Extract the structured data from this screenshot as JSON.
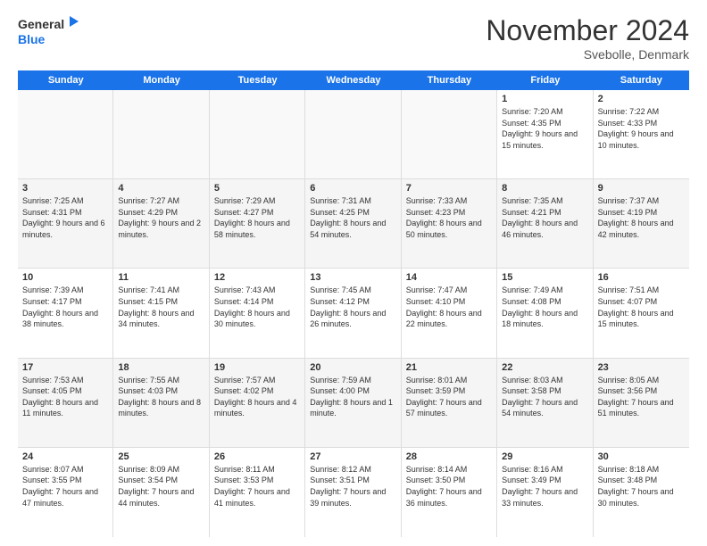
{
  "header": {
    "logo_general": "General",
    "logo_blue": "Blue",
    "month_title": "November 2024",
    "location": "Svebolle, Denmark"
  },
  "calendar": {
    "days_of_week": [
      "Sunday",
      "Monday",
      "Tuesday",
      "Wednesday",
      "Thursday",
      "Friday",
      "Saturday"
    ],
    "weeks": [
      [
        {
          "day": "",
          "empty": true
        },
        {
          "day": "",
          "empty": true
        },
        {
          "day": "",
          "empty": true
        },
        {
          "day": "",
          "empty": true
        },
        {
          "day": "",
          "empty": true
        },
        {
          "day": "1",
          "sunrise": "7:20 AM",
          "sunset": "4:35 PM",
          "daylight": "9 hours and 15 minutes."
        },
        {
          "day": "2",
          "sunrise": "7:22 AM",
          "sunset": "4:33 PM",
          "daylight": "9 hours and 10 minutes."
        }
      ],
      [
        {
          "day": "3",
          "sunrise": "7:25 AM",
          "sunset": "4:31 PM",
          "daylight": "9 hours and 6 minutes."
        },
        {
          "day": "4",
          "sunrise": "7:27 AM",
          "sunset": "4:29 PM",
          "daylight": "9 hours and 2 minutes."
        },
        {
          "day": "5",
          "sunrise": "7:29 AM",
          "sunset": "4:27 PM",
          "daylight": "8 hours and 58 minutes."
        },
        {
          "day": "6",
          "sunrise": "7:31 AM",
          "sunset": "4:25 PM",
          "daylight": "8 hours and 54 minutes."
        },
        {
          "day": "7",
          "sunrise": "7:33 AM",
          "sunset": "4:23 PM",
          "daylight": "8 hours and 50 minutes."
        },
        {
          "day": "8",
          "sunrise": "7:35 AM",
          "sunset": "4:21 PM",
          "daylight": "8 hours and 46 minutes."
        },
        {
          "day": "9",
          "sunrise": "7:37 AM",
          "sunset": "4:19 PM",
          "daylight": "8 hours and 42 minutes."
        }
      ],
      [
        {
          "day": "10",
          "sunrise": "7:39 AM",
          "sunset": "4:17 PM",
          "daylight": "8 hours and 38 minutes."
        },
        {
          "day": "11",
          "sunrise": "7:41 AM",
          "sunset": "4:15 PM",
          "daylight": "8 hours and 34 minutes."
        },
        {
          "day": "12",
          "sunrise": "7:43 AM",
          "sunset": "4:14 PM",
          "daylight": "8 hours and 30 minutes."
        },
        {
          "day": "13",
          "sunrise": "7:45 AM",
          "sunset": "4:12 PM",
          "daylight": "8 hours and 26 minutes."
        },
        {
          "day": "14",
          "sunrise": "7:47 AM",
          "sunset": "4:10 PM",
          "daylight": "8 hours and 22 minutes."
        },
        {
          "day": "15",
          "sunrise": "7:49 AM",
          "sunset": "4:08 PM",
          "daylight": "8 hours and 18 minutes."
        },
        {
          "day": "16",
          "sunrise": "7:51 AM",
          "sunset": "4:07 PM",
          "daylight": "8 hours and 15 minutes."
        }
      ],
      [
        {
          "day": "17",
          "sunrise": "7:53 AM",
          "sunset": "4:05 PM",
          "daylight": "8 hours and 11 minutes."
        },
        {
          "day": "18",
          "sunrise": "7:55 AM",
          "sunset": "4:03 PM",
          "daylight": "8 hours and 8 minutes."
        },
        {
          "day": "19",
          "sunrise": "7:57 AM",
          "sunset": "4:02 PM",
          "daylight": "8 hours and 4 minutes."
        },
        {
          "day": "20",
          "sunrise": "7:59 AM",
          "sunset": "4:00 PM",
          "daylight": "8 hours and 1 minute."
        },
        {
          "day": "21",
          "sunrise": "8:01 AM",
          "sunset": "3:59 PM",
          "daylight": "7 hours and 57 minutes."
        },
        {
          "day": "22",
          "sunrise": "8:03 AM",
          "sunset": "3:58 PM",
          "daylight": "7 hours and 54 minutes."
        },
        {
          "day": "23",
          "sunrise": "8:05 AM",
          "sunset": "3:56 PM",
          "daylight": "7 hours and 51 minutes."
        }
      ],
      [
        {
          "day": "24",
          "sunrise": "8:07 AM",
          "sunset": "3:55 PM",
          "daylight": "7 hours and 47 minutes."
        },
        {
          "day": "25",
          "sunrise": "8:09 AM",
          "sunset": "3:54 PM",
          "daylight": "7 hours and 44 minutes."
        },
        {
          "day": "26",
          "sunrise": "8:11 AM",
          "sunset": "3:53 PM",
          "daylight": "7 hours and 41 minutes."
        },
        {
          "day": "27",
          "sunrise": "8:12 AM",
          "sunset": "3:51 PM",
          "daylight": "7 hours and 39 minutes."
        },
        {
          "day": "28",
          "sunrise": "8:14 AM",
          "sunset": "3:50 PM",
          "daylight": "7 hours and 36 minutes."
        },
        {
          "day": "29",
          "sunrise": "8:16 AM",
          "sunset": "3:49 PM",
          "daylight": "7 hours and 33 minutes."
        },
        {
          "day": "30",
          "sunrise": "8:18 AM",
          "sunset": "3:48 PM",
          "daylight": "7 hours and 30 minutes."
        }
      ]
    ]
  }
}
